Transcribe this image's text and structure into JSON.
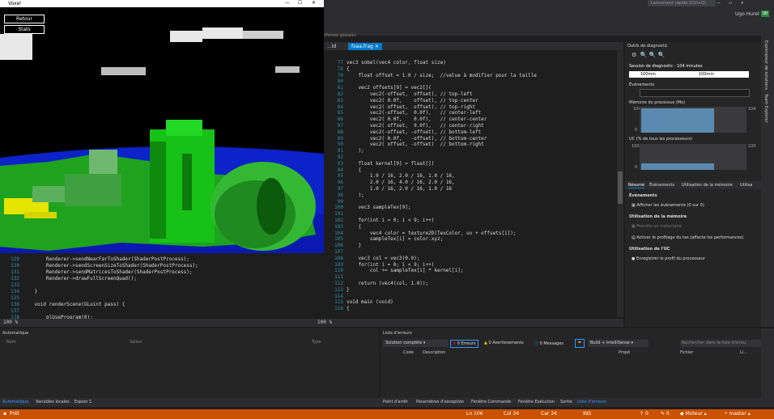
{
  "game": {
    "title": "Voxel",
    "buttons": [
      "Retour",
      "Stats"
    ],
    "colors": {
      "sky": "#000000",
      "ocean": "#0b23c8",
      "grass": "#1fa31f",
      "sand": "#e5e500"
    }
  },
  "ide": {
    "search_placeholder": "Lancement rapide (Ctrl+Q)",
    "user": "Ugo Hurel",
    "user_badge": "UH",
    "breadcrumb": "(Portée globale)",
    "tabs": {
      "left": "...ld",
      "active": "fxaa.frag"
    },
    "accent": "#007acc",
    "status_color": "#ca5100"
  },
  "editor": {
    "lines": [
      {
        "n": "77",
        "code": "vec3 sobel(vec4 color, float size)"
      },
      {
        "n": "78",
        "code": "{"
      },
      {
        "n": "79",
        "code": "    float offset = 1.0 / size;  //value à modifier pour la taille"
      },
      {
        "n": "80",
        "code": ""
      },
      {
        "n": "81",
        "code": "    vec2 offsets[9] = vec2[]("
      },
      {
        "n": "82",
        "code": "        vec2(-offset,  offset), // top-left"
      },
      {
        "n": "83",
        "code": "        vec2( 0.0f,    offset), // top-center"
      },
      {
        "n": "84",
        "code": "        vec2( offset,  offset), // top-right"
      },
      {
        "n": "85",
        "code": "        vec2(-offset,  0.0f),   // center-left"
      },
      {
        "n": "86",
        "code": "        vec2( 0.0f,    0.0f),   // center-center"
      },
      {
        "n": "87",
        "code": "        vec2( offset,  0.0f),   // center-right"
      },
      {
        "n": "88",
        "code": "        vec2(-offset, -offset), // bottom-left"
      },
      {
        "n": "89",
        "code": "        vec2( 0.0f,   -offset), // bottom-center"
      },
      {
        "n": "90",
        "code": "        vec2( offset, -offset)  // bottom-right"
      },
      {
        "n": "91",
        "code": "    );"
      },
      {
        "n": "92",
        "code": ""
      },
      {
        "n": "93",
        "code": "    float kernel[9] = float[]("
      },
      {
        "n": "94",
        "code": "    {"
      },
      {
        "n": "95",
        "code": "        1.0 / 16, 2.0 / 16, 1.0 / 16,"
      },
      {
        "n": "96",
        "code": "        2.0 / 16, 4.0 / 16, 2.0 / 16,"
      },
      {
        "n": "97",
        "code": "        1.0 / 16, 2.0 / 16, 1.0 / 16"
      },
      {
        "n": "98",
        "code": "    );"
      },
      {
        "n": "99",
        "code": ""
      },
      {
        "n": "100",
        "code": "    vec3 sampleTex[9];"
      },
      {
        "n": "101",
        "code": ""
      },
      {
        "n": "102",
        "code": "    for(int i = 0; i < 9; i++)"
      },
      {
        "n": "103",
        "code": "    {"
      },
      {
        "n": "104",
        "code": "        vec4 color = texture2D(TexColor, uv + offsets[i]);"
      },
      {
        "n": "105",
        "code": "        sampleTex[i] = color.xyz;"
      },
      {
        "n": "106",
        "code": "    }"
      },
      {
        "n": "107",
        "code": ""
      },
      {
        "n": "108",
        "code": "    vec3 col = vec3(0.0);"
      },
      {
        "n": "109",
        "code": "    for(int i = 0; i < 9; i++)"
      },
      {
        "n": "110",
        "code": "        col += sampleTex[i] * kernel[i];"
      },
      {
        "n": "111",
        "code": ""
      },
      {
        "n": "112",
        "code": "    return (vec4(col, 1.0));"
      },
      {
        "n": "113",
        "code": "}"
      },
      {
        "n": "114",
        "code": ""
      },
      {
        "n": "115",
        "code": "void main (void)"
      },
      {
        "n": "116",
        "code": "{"
      }
    ],
    "zoom": "100 %"
  },
  "editor2": {
    "lines": [
      {
        "n": "129",
        "code": "        Renderer->sendNearFarToShader(ShaderPostProcess);"
      },
      {
        "n": "130",
        "code": "        Renderer->sendScreenSizeToShader(ShaderPostProcess);"
      },
      {
        "n": "131",
        "code": "        Renderer->sendMatricesToShader(ShaderPostProcess);"
      },
      {
        "n": "132",
        "code": "        Renderer->drawFullScreenQuad();"
      },
      {
        "n": "133",
        "code": ""
      },
      {
        "n": "134",
        "code": "    }"
      },
      {
        "n": "135",
        "code": ""
      },
      {
        "n": "136",
        "code": "    void renderScene(GLuint pass) {"
      },
      {
        "n": "137",
        "code": ""
      },
      {
        "n": "138",
        "code": "        glUseProgram(0);"
      }
    ],
    "zoom": "100 %"
  },
  "diagnostics": {
    "title": "Outils de diagnostic",
    "session": "Session de diagnostic : 104 minutes",
    "ticks": [
      "100min",
      "100min"
    ],
    "events_label": "Événements",
    "memory_label": "Mémoire du processus (Mo)",
    "memory_max": "104",
    "memory_min": "0",
    "cpu_label": "UC (% de tous les processeurs)",
    "cpu_max": "100",
    "cpu_min": "0",
    "tabs": [
      "Résumé",
      "Événements",
      "Utilisation de la mémoire",
      "Utilisa"
    ],
    "sec_events": "Événements",
    "show_events": "Afficher les événements (0 sur 0)",
    "sec_memory": "Utilisation de la mémoire",
    "take_snapshot": "Prendre un instantané",
    "heap_profiling": "Activer le profilage du tas (affecte les performances)",
    "sec_cpu": "Utilisation de l'UC",
    "cpu_profile": "Enregistrer le profil du processeur",
    "side_tabs": [
      "Explorateur de solutions",
      "Team Explorer"
    ]
  },
  "auto_panel": {
    "title": "Automatique",
    "columns": [
      "Nom",
      "Valeur",
      "Type"
    ]
  },
  "errors_panel": {
    "title": "Liste d'erreurs",
    "scope": "Solution complète",
    "errors": "0 Erreurs",
    "warnings": "0 Avertissements",
    "messages": "0 Messages",
    "build": "Build + IntelliSense",
    "search": "Rechercher dans la liste d'erreu",
    "columns": [
      "Code",
      "Description",
      "Projet",
      "Fichier",
      "Li..."
    ]
  },
  "bottom_tabs": {
    "left": [
      "Automatique",
      "Variables locales",
      "Espion 1"
    ],
    "right": [
      "Point d'arrêt",
      "Paramètres d'exception",
      "Fenêtre Commande",
      "Fenêtre Exécution",
      "Sortie",
      "Liste d'erreurs"
    ]
  },
  "statusbar": {
    "state": "Prêt",
    "line": "Ln 106",
    "col": "Col 34",
    "car": "Car 34",
    "ins": "INS",
    "up": "0",
    "pencil": "0",
    "repo": "Moteur",
    "branch": "master"
  }
}
